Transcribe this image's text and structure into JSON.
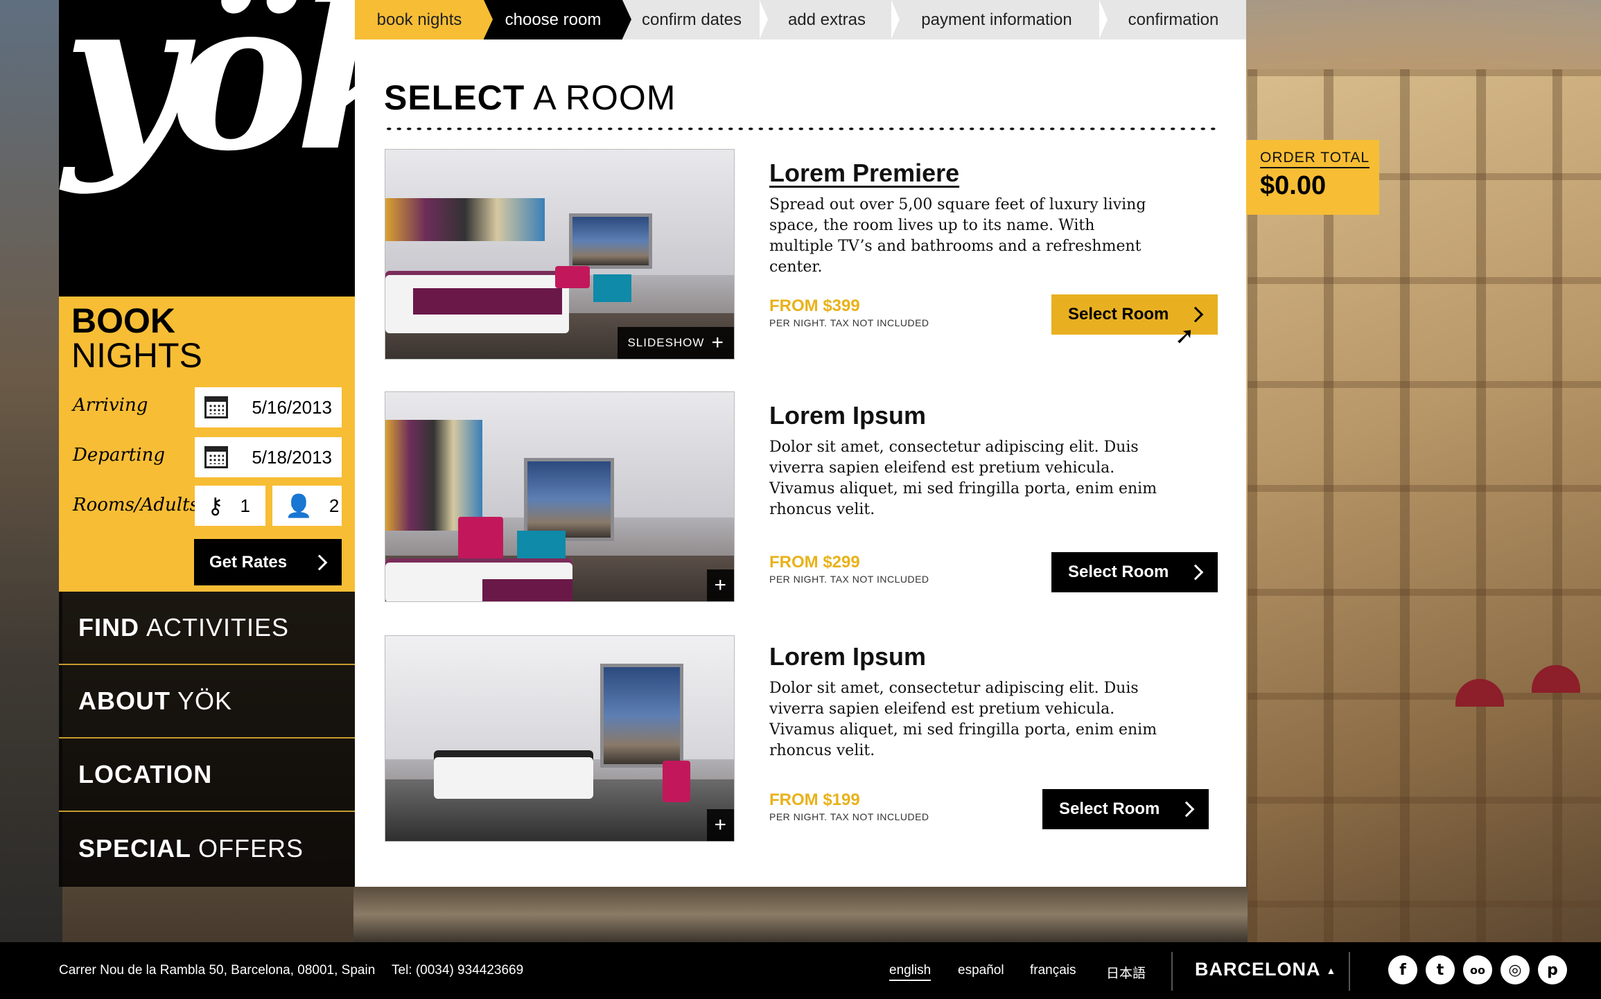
{
  "brand": {
    "logo_text": "yök"
  },
  "steps": [
    {
      "label": "book nights",
      "state": "done"
    },
    {
      "label": "choose room",
      "state": "active"
    },
    {
      "label": "confirm dates",
      "state": "upcoming"
    },
    {
      "label": "add extras",
      "state": "upcoming"
    },
    {
      "label": "payment information",
      "state": "upcoming"
    },
    {
      "label": "confirmation",
      "state": "upcoming"
    }
  ],
  "book": {
    "title_bold": "BOOK",
    "title_light": "NIGHTS",
    "arriving_label": "Arriving",
    "arriving_value": "5/16/2013",
    "departing_label": "Departing",
    "departing_value": "5/18/2013",
    "rooms_adults_label": "Rooms/Adults",
    "rooms_value": "1",
    "adults_value": "2",
    "get_rates_label": "Get Rates"
  },
  "nav": [
    {
      "bold": "FIND",
      "light": "ACTIVITIES"
    },
    {
      "bold": "ABOUT",
      "light": "YÖK"
    },
    {
      "bold": "LOCATION",
      "light": ""
    },
    {
      "bold": "SPECIAL",
      "light": "OFFERS"
    }
  ],
  "main": {
    "title_bold": "SELECT",
    "title_light": "A ROOM"
  },
  "rooms": [
    {
      "name": "Lorem Premiere",
      "description": "Spread out over 5,00 square feet of luxury living space, the room lives up to its name. With multiple TV’s and bathrooms and a refreshment center.",
      "price": "FROM $399",
      "note": "PER NIGHT. TAX NOT INCLUDED",
      "button": "Select Room",
      "overlay_label": "SLIDESHOW",
      "overlay_plus": "+"
    },
    {
      "name": "Lorem Ipsum",
      "description": "Dolor sit amet, consectetur adipiscing elit. Duis viverra sapien eleifend est pretium vehicula. Vivamus aliquet, mi sed fringilla porta, enim enim rhoncus velit.",
      "price": "FROM $299",
      "note": "PER NIGHT. TAX NOT INCLUDED",
      "button": "Select Room",
      "overlay_plus": "+"
    },
    {
      "name": "Lorem Ipsum",
      "description": "Dolor sit amet, consectetur adipiscing elit. Duis viverra sapien eleifend est pretium vehicula. Vivamus aliquet, mi sed fringilla porta, enim enim rhoncus velit.",
      "price": "FROM $199",
      "note": "PER NIGHT. TAX NOT INCLUDED",
      "button": "Select Room",
      "overlay_plus": "+"
    }
  ],
  "order_total": {
    "label": "ORDER TOTAL",
    "value": "$0.00"
  },
  "footer": {
    "address": "Carrer Nou de la Rambla 50, Barcelona, 08001, Spain",
    "phone": "Tel: (0034) 934423669",
    "languages": [
      "english",
      "español",
      "français",
      "日本語"
    ],
    "active_language": "english",
    "city": "BARCELONA",
    "social": [
      {
        "icon": "facebook-icon",
        "glyph": "f"
      },
      {
        "icon": "twitter-icon",
        "glyph": "t"
      },
      {
        "icon": "tripadvisor-icon",
        "glyph": "oo"
      },
      {
        "icon": "instagram-icon",
        "glyph": "◎"
      },
      {
        "icon": "pinterest-icon",
        "glyph": "p"
      }
    ]
  },
  "colors": {
    "accent": "#f7bd35",
    "button_gold": "#e8b021",
    "dark": "#000000"
  }
}
